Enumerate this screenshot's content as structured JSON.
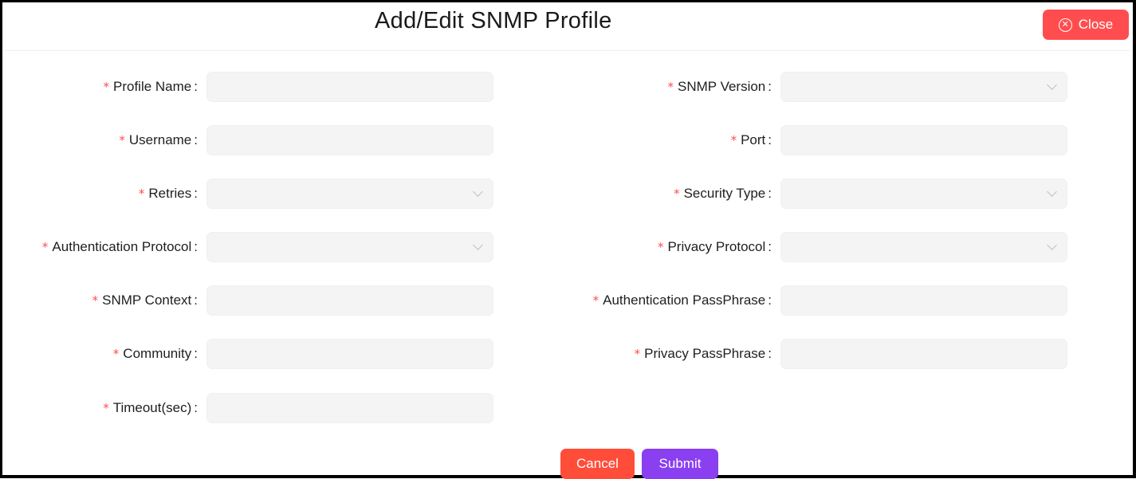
{
  "dialog": {
    "title": "Add/Edit SNMP Profile",
    "close_label": "Close"
  },
  "form": {
    "required_mark": "*",
    "left": [
      {
        "label": "Profile Name",
        "type": "input",
        "value": ""
      },
      {
        "label": "Username",
        "type": "input",
        "value": ""
      },
      {
        "label": "Retries",
        "type": "select",
        "value": ""
      },
      {
        "label": "Authentication Protocol",
        "type": "select",
        "value": ""
      },
      {
        "label": "SNMP Context",
        "type": "input",
        "value": ""
      },
      {
        "label": "Community",
        "type": "input",
        "value": ""
      },
      {
        "label": "Timeout(sec)",
        "type": "input",
        "value": ""
      }
    ],
    "right": [
      {
        "label": "SNMP Version",
        "type": "select",
        "value": ""
      },
      {
        "label": "Port",
        "type": "input",
        "value": ""
      },
      {
        "label": "Security Type",
        "type": "select",
        "value": ""
      },
      {
        "label": "Privacy Protocol",
        "type": "select",
        "value": ""
      },
      {
        "label": "Authentication PassPhrase",
        "type": "input",
        "value": ""
      },
      {
        "label": "Privacy PassPhrase",
        "type": "input",
        "value": ""
      }
    ]
  },
  "actions": {
    "cancel_label": "Cancel",
    "submit_label": "Submit"
  },
  "colors": {
    "danger": "#ff4d4f",
    "primary": "#8a3ff0",
    "field_bg": "#f4f4f4"
  }
}
